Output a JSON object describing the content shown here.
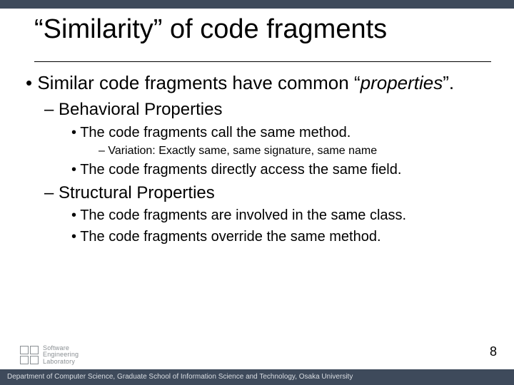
{
  "title": "“Similarity” of code fragments",
  "bullets": {
    "b1_pre": "Similar code fragments have common “",
    "b1_em": "properties",
    "b1_post": "”.",
    "b2a": "Behavioral Properties",
    "b2a_1": "The code fragments call the same method.",
    "b2a_1_v": "Variation: Exactly same, same signature, same name",
    "b2a_2": "The code fragments directly access the same field.",
    "b2b": "Structural Properties",
    "b2b_1": "The code fragments are involved in the same class.",
    "b2b_2": "The code fragments override the same method."
  },
  "page_number": "8",
  "footer": "Department of Computer Science, Graduate School of Information Science and Technology, Osaka University",
  "logo": {
    "line1": "Software",
    "line2": "Engineering",
    "line3": "Laboratory"
  }
}
